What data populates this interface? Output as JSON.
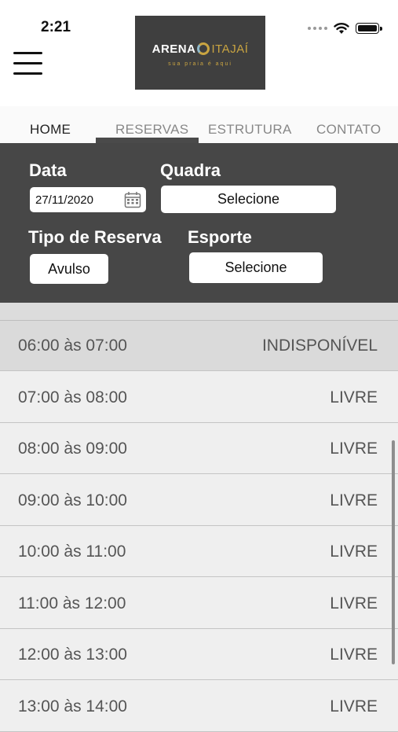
{
  "status_bar": {
    "time": "2:21"
  },
  "logo": {
    "word1": "ARENA",
    "word2": "ITAJAÍ",
    "tagline": "sua praia é aqui"
  },
  "nav": {
    "tabs": [
      {
        "label": "HOME"
      },
      {
        "label": "RESERVAS"
      },
      {
        "label": "ESTRUTURA"
      },
      {
        "label": "CONTATO"
      }
    ],
    "active_tab": "RESERVAS"
  },
  "filters": {
    "date_label": "Data",
    "date_value": "27/11/2020",
    "court_label": "Quadra",
    "court_value": "Selecione",
    "booking_type_label": "Tipo de Reserva",
    "booking_type_value": "Avulso",
    "sport_label": "Esporte",
    "sport_value": "Selecione"
  },
  "slots": [
    {
      "time": "06:00 às 07:00",
      "status": "INDISPONÍVEL"
    },
    {
      "time": "07:00 às 08:00",
      "status": "LIVRE"
    },
    {
      "time": "08:00 às 09:00",
      "status": "LIVRE"
    },
    {
      "time": "09:00 às 10:00",
      "status": "LIVRE"
    },
    {
      "time": "10:00 às 11:00",
      "status": "LIVRE"
    },
    {
      "time": "11:00 às 12:00",
      "status": "LIVRE"
    },
    {
      "time": "12:00 às 13:00",
      "status": "LIVRE"
    },
    {
      "time": "13:00 às 14:00",
      "status": "LIVRE"
    }
  ],
  "colors": {
    "panel": "#474747",
    "accent_gold": "#c9a441",
    "row_unavailable": "#dadada",
    "row_free": "#efefef"
  }
}
